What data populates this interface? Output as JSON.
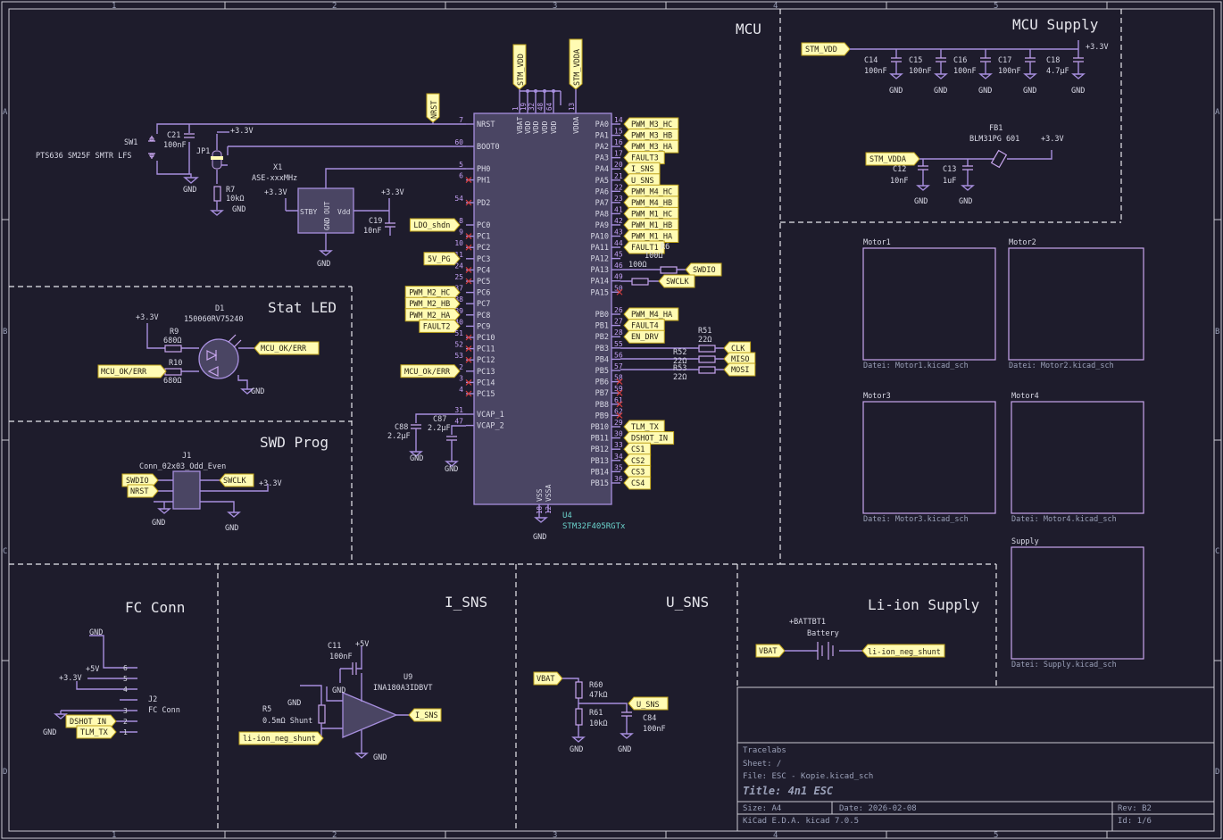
{
  "sheet": {
    "title_block": {
      "company": "Tracelabs",
      "sheet": "Sheet: /",
      "file": "File: ESC - Kopie.kicad_sch",
      "title": "Title: 4n1 ESC",
      "size": "Size: A4",
      "date": "Date: 2026-02-08",
      "rev": "Rev: B2",
      "tool": "KiCad E.D.A.  kicad 7.0.5",
      "id": "Id: 1/6"
    },
    "frame": {
      "cols": [
        "1",
        "2",
        "3",
        "4",
        "5"
      ],
      "rows": [
        "A",
        "B",
        "C",
        "D"
      ]
    },
    "sections": {
      "mcu": "MCU",
      "mcu_supply": "MCU Supply",
      "stat_led": "Stat LED",
      "swd_prog": "SWD Prog",
      "fc_conn": "FC Conn",
      "i_sns": "I_SNS",
      "u_sns": "U_SNS",
      "li_ion": "Li-ion Supply"
    }
  },
  "mcu": {
    "ref": "U4",
    "value": "STM32F405RGTx",
    "top_labels": [
      "STM_VDD",
      "STM_VDDA"
    ],
    "top_pins": [
      {
        "num": "1",
        "name": "VBAT"
      },
      {
        "num": "19",
        "name": "VDD"
      },
      {
        "num": "32",
        "name": "VDD"
      },
      {
        "num": "48",
        "name": "VDD"
      },
      {
        "num": "64",
        "name": "VDD"
      },
      {
        "num": "13",
        "name": "VDDA"
      }
    ],
    "bottom_pins": [
      {
        "num": "18",
        "name": "VSS"
      },
      {
        "num": "12",
        "name": "VSSA"
      }
    ],
    "left_pins": [
      {
        "num": "7",
        "name": "NRST",
        "label": "NRST"
      },
      {
        "num": "60",
        "name": "BOOT0",
        "label": ""
      },
      {
        "num": "5",
        "name": "PH0",
        "label": ""
      },
      {
        "num": "6",
        "name": "PH1",
        "label": ""
      },
      {
        "num": "54",
        "name": "PD2",
        "label": ""
      },
      {
        "num": "8",
        "name": "PC0",
        "label": "LDO_shdn"
      },
      {
        "num": "9",
        "name": "PC1",
        "label": ""
      },
      {
        "num": "10",
        "name": "PC2",
        "label": ""
      },
      {
        "num": "11",
        "name": "PC3",
        "label": "5V_PG"
      },
      {
        "num": "24",
        "name": "PC4",
        "label": ""
      },
      {
        "num": "25",
        "name": "PC5",
        "label": ""
      },
      {
        "num": "37",
        "name": "PC6",
        "label": "PWM_M2_HC"
      },
      {
        "num": "38",
        "name": "PC7",
        "label": "PWM_M2_HB"
      },
      {
        "num": "39",
        "name": "PC8",
        "label": "PWM_M2_HA"
      },
      {
        "num": "40",
        "name": "PC9",
        "label": "FAULT2"
      },
      {
        "num": "51",
        "name": "PC10",
        "label": ""
      },
      {
        "num": "52",
        "name": "PC11",
        "label": ""
      },
      {
        "num": "53",
        "name": "PC12",
        "label": ""
      },
      {
        "num": "2",
        "name": "PC13",
        "label": "MCU_Ok/ERR"
      },
      {
        "num": "3",
        "name": "PC14",
        "label": ""
      },
      {
        "num": "4",
        "name": "PC15",
        "label": ""
      },
      {
        "num": "31",
        "name": "VCAP_1",
        "label": ""
      },
      {
        "num": "47",
        "name": "VCAP_2",
        "label": ""
      }
    ],
    "right_pins": [
      {
        "num": "14",
        "name": "PA0",
        "label": "PWM_M3_HC"
      },
      {
        "num": "15",
        "name": "PA1",
        "label": "PWM_M3_HB"
      },
      {
        "num": "16",
        "name": "PA2",
        "label": "PWM_M3_HA"
      },
      {
        "num": "17",
        "name": "PA3",
        "label": "FAULT3"
      },
      {
        "num": "20",
        "name": "PA4",
        "label": "I_SNS"
      },
      {
        "num": "21",
        "name": "PA5",
        "label": "U_SNS"
      },
      {
        "num": "22",
        "name": "PA6",
        "label": "PWM_M4_HC"
      },
      {
        "num": "23",
        "name": "PA7",
        "label": "PWM_M4_HB"
      },
      {
        "num": "41",
        "name": "PA8",
        "label": "PWM_M1_HC"
      },
      {
        "num": "42",
        "name": "PA9",
        "label": "PWM_M1_HB"
      },
      {
        "num": "43",
        "name": "PA10",
        "label": "PWM_M1_HA"
      },
      {
        "num": "44",
        "name": "PA11",
        "label": "FAULT1"
      },
      {
        "num": "45",
        "name": "PA12",
        "label": ""
      },
      {
        "num": "46",
        "name": "PA13",
        "label": ""
      },
      {
        "num": "49",
        "name": "PA14",
        "label": ""
      },
      {
        "num": "50",
        "name": "PA15",
        "label": ""
      },
      {
        "num": "26",
        "name": "PB0",
        "label": "PWM_M4_HA"
      },
      {
        "num": "27",
        "name": "PB1",
        "label": "FAULT4"
      },
      {
        "num": "28",
        "name": "PB2",
        "label": "EN_DRV"
      },
      {
        "num": "55",
        "name": "PB3",
        "label": ""
      },
      {
        "num": "56",
        "name": "PB4",
        "label": ""
      },
      {
        "num": "57",
        "name": "PB5",
        "label": ""
      },
      {
        "num": "58",
        "name": "PB6",
        "label": ""
      },
      {
        "num": "59",
        "name": "PB7",
        "label": ""
      },
      {
        "num": "61",
        "name": "PB8",
        "label": ""
      },
      {
        "num": "62",
        "name": "PB9",
        "label": ""
      },
      {
        "num": "29",
        "name": "PB10",
        "label": "TLM_TX"
      },
      {
        "num": "30",
        "name": "PB11",
        "label": "DSHOT_IN"
      },
      {
        "num": "33",
        "name": "PB12",
        "label": "CS1"
      },
      {
        "num": "34",
        "name": "PB13",
        "label": "CS2"
      },
      {
        "num": "35",
        "name": "PB14",
        "label": "CS3"
      },
      {
        "num": "36",
        "name": "PB15",
        "label": "CS4"
      }
    ],
    "resistors": {
      "r6": {
        "ref": "R6",
        "value": "100Ω",
        "label": "SWDIO"
      },
      "r6b": {
        "value": "100Ω",
        "label": "SWCLK"
      },
      "r51": {
        "ref": "R51",
        "value": "22Ω",
        "label": "CLK"
      },
      "r52": {
        "ref": "R52",
        "value": "22Ω",
        "label": "MISO"
      },
      "r53": {
        "ref": "R53",
        "value": "22Ω",
        "label": "MOSI"
      }
    },
    "sw1": {
      "ref": "SW1",
      "value": "PTS636 SM25F SMTR LFS"
    },
    "c21": {
      "ref": "C21",
      "value": "100nF"
    },
    "jp1": {
      "ref": "JP1"
    },
    "r7": {
      "ref": "R7",
      "value": "10kΩ"
    },
    "x1": {
      "ref": "X1",
      "value": "ASE-xxxMHz",
      "stby": "STBY",
      "vdd": "Vdd",
      "out": "OUT",
      "gnd": "GND"
    },
    "c19": {
      "ref": "C19",
      "value": "10nF"
    },
    "c88": {
      "ref": "C88",
      "value": "2.2µF"
    },
    "c87": {
      "ref": "C87",
      "value": "2.2µF"
    },
    "pwr": {
      "v33": "+3.3V",
      "gnd": "GND",
      "v5": "+5V"
    }
  },
  "mcu_supply": {
    "label_vdd": "STM_VDD",
    "label_vdda": "STM_VDDA",
    "caps": [
      {
        "ref": "C14",
        "value": "100nF"
      },
      {
        "ref": "C15",
        "value": "100nF"
      },
      {
        "ref": "C16",
        "value": "100nF"
      },
      {
        "ref": "C17",
        "value": "100nF"
      },
      {
        "ref": "C18",
        "value": "4.7µF"
      }
    ],
    "c12": {
      "ref": "C12",
      "value": "10nF"
    },
    "c13": {
      "ref": "C13",
      "value": "1uF"
    },
    "fb1": {
      "ref": "FB1",
      "value": "BLM31PG 601"
    }
  },
  "stat_led": {
    "d1": {
      "ref": "D1",
      "value": "150060RV75240"
    },
    "r9": {
      "ref": "R9",
      "value": "680Ω"
    },
    "r10": {
      "ref": "R10",
      "value": "680Ω"
    },
    "label_out": "MCU_OK/ERR",
    "label_in": "MCU_OK/ERR"
  },
  "swd": {
    "j1": {
      "ref": "J1",
      "value": "Conn_02x03_Odd_Even"
    },
    "labels": [
      "SWDIO",
      "NRST",
      "SWCLK"
    ]
  },
  "sheets": [
    {
      "name": "Motor1",
      "file": "Datei: Motor1.kicad_sch"
    },
    {
      "name": "Motor2",
      "file": "Datei: Motor2.kicad_sch"
    },
    {
      "name": "Motor3",
      "file": "Datei: Motor3.kicad_sch"
    },
    {
      "name": "Motor4",
      "file": "Datei: Motor4.kicad_sch"
    },
    {
      "name": "Supply",
      "file": "Datei: Supply.kicad_sch"
    }
  ],
  "fc_conn": {
    "j2": {
      "ref": "J2",
      "value": "FC Conn"
    },
    "labels": [
      "DSHOT_IN",
      "TLM_TX"
    ],
    "pins": [
      "6",
      "5",
      "4",
      "3",
      "2",
      "1"
    ]
  },
  "i_sns": {
    "c11": {
      "ref": "C11",
      "value": "100nF"
    },
    "u9": {
      "ref": "U9",
      "value": "INA180A3IDBVT"
    },
    "r5": {
      "ref": "R5",
      "value": "0.5mΩ Shunt"
    },
    "label_in": "li-ion_neg_shunt",
    "label_out": "I_SNS"
  },
  "u_sns": {
    "label_in": "VBAT",
    "label_out": "U_SNS",
    "r60": {
      "ref": "R60",
      "value": "47kΩ"
    },
    "r61": {
      "ref": "R61",
      "value": "10kΩ"
    },
    "c84": {
      "ref": "C84",
      "value": "100nF"
    }
  },
  "li_ion": {
    "bt1": {
      "ref": "+BATTBT1",
      "value": "Battery"
    },
    "label_in": "VBAT",
    "label_out": "li-ion_neg_shunt"
  }
}
